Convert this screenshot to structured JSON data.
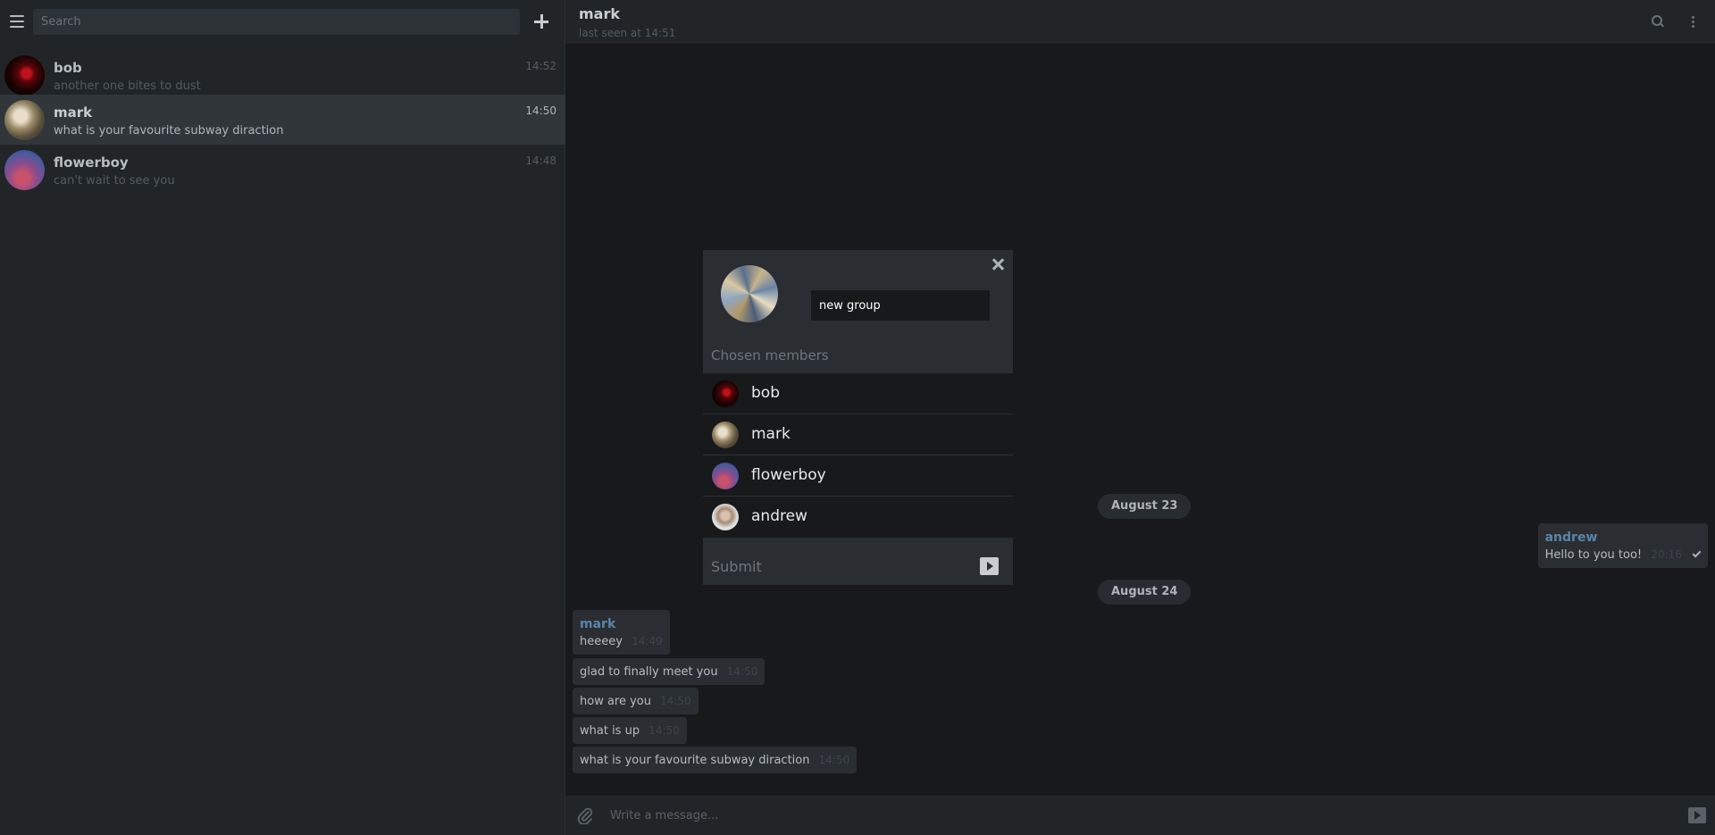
{
  "sidebar": {
    "search_placeholder": "Search",
    "chats": [
      {
        "name": "bob",
        "preview": "another one bites to dust",
        "time": "14:52",
        "active": false
      },
      {
        "name": "mark",
        "preview": "what is your favourite subway diraction",
        "time": "14:50",
        "active": true
      },
      {
        "name": "flowerboy",
        "preview": "can't wait to see you",
        "time": "14:48",
        "active": false
      }
    ]
  },
  "header": {
    "name": "mark",
    "status": "last seen at 14:51"
  },
  "messages": {
    "dates": [
      "August 23",
      "August 24"
    ],
    "outgoing": {
      "sender": "andrew",
      "text": "Hello to you too!",
      "time": "20:16"
    },
    "incoming_sender": "mark",
    "incoming": [
      {
        "text": "heeeey",
        "time": "14:49"
      },
      {
        "text": "glad to finally meet you",
        "time": "14:50"
      },
      {
        "text": "how are you",
        "time": "14:50"
      },
      {
        "text": "what is up",
        "time": "14:50"
      },
      {
        "text": "what is your favourite subway diraction",
        "time": "14:50"
      }
    ]
  },
  "composer": {
    "placeholder": "Write a message..."
  },
  "modal": {
    "group_name_value": "new group",
    "members_title": "Chosen members",
    "members": [
      {
        "name": "bob"
      },
      {
        "name": "mark"
      },
      {
        "name": "flowerboy"
      },
      {
        "name": "andrew"
      }
    ],
    "submit_label": "Submit"
  }
}
